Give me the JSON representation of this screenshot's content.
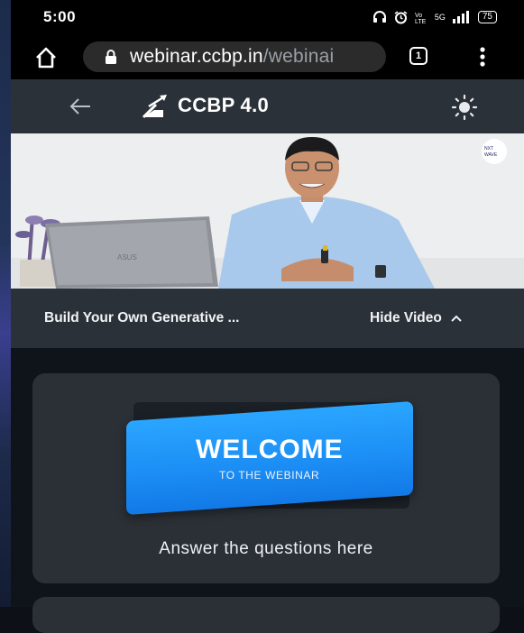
{
  "status_bar": {
    "time": "5:00",
    "battery": "75",
    "network": "5G"
  },
  "browser": {
    "url_main": "webinar.ccbp.in",
    "url_rest": "/webinai",
    "tab_count": "1"
  },
  "header": {
    "brand": "CCBP 4.0"
  },
  "video": {
    "title": "Build Your Own Generative ...",
    "hide_label": "Hide Video",
    "watermark": "NXT WAVE"
  },
  "card": {
    "welcome_title": "WELCOME",
    "welcome_sub": "TO THE WEBINAR",
    "answer_text": "Answer the questions here"
  },
  "colors": {
    "accent_blue": "#1c8ff5",
    "header_bg": "#2b3138",
    "card_bg": "#2b3036"
  }
}
